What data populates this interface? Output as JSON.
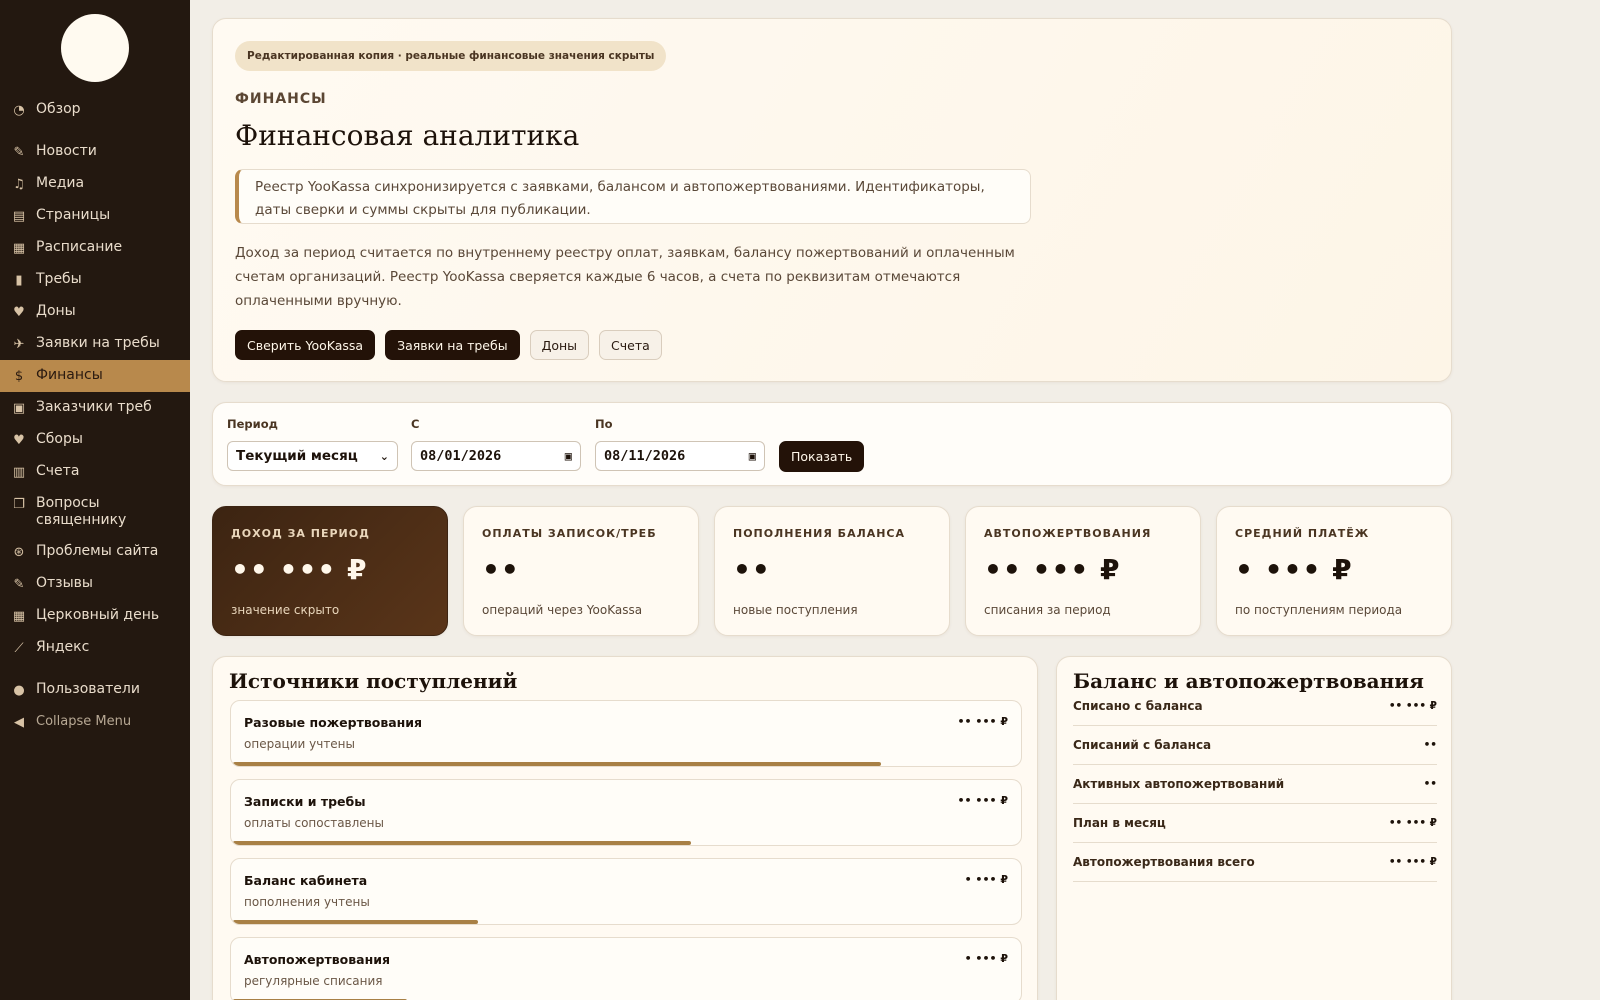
{
  "sidebar": {
    "items": [
      {
        "label": "Обзор",
        "icon": "dashboard-icon"
      },
      {
        "label": "Новости",
        "icon": "pin-icon"
      },
      {
        "label": "Медиа",
        "icon": "media-icon"
      },
      {
        "label": "Страницы",
        "icon": "pages-icon"
      },
      {
        "label": "Расписание",
        "icon": "calendar-icon"
      },
      {
        "label": "Требы",
        "icon": "book-icon"
      },
      {
        "label": "Доны",
        "icon": "heart-icon"
      },
      {
        "label": "Заявки на требы",
        "icon": "send-icon"
      },
      {
        "label": "Финансы",
        "icon": "dollar-icon"
      },
      {
        "label": "Заказчики треб",
        "icon": "id-card-icon"
      },
      {
        "label": "Сборы",
        "icon": "heart-icon"
      },
      {
        "label": "Счета",
        "icon": "invoice-icon"
      },
      {
        "label": "Вопросы священнику",
        "icon": "chat-icon"
      },
      {
        "label": "Проблемы сайта",
        "icon": "lifebuoy-icon"
      },
      {
        "label": "Отзывы",
        "icon": "pin-icon"
      },
      {
        "label": "Церковный день",
        "icon": "calendar-icon"
      },
      {
        "label": "Яндекс",
        "icon": "chart-icon"
      },
      {
        "label": "Пользователи",
        "icon": "user-icon"
      },
      {
        "label": "Collapse Menu",
        "icon": "collapse-icon"
      }
    ]
  },
  "hero": {
    "pill": "Редактированная копия · реальные финансовые значения скрыты",
    "eyebrow": "ФИНАНСЫ",
    "title": "Финансовая аналитика",
    "note": "Реестр YooKassa синхронизируется с заявками, балансом и автопожертвованиями. Идентификаторы, даты сверки и суммы скрыты для публикации.",
    "description": "Доход за период считается по внутреннему реестру оплат, заявкам, балансу пожертвований и оплаченным счетам организаций. Реестр YooKassa сверяется каждые 6 часов, а счета по реквизитам отмечаются оплаченными вручную.",
    "buttons": {
      "reconcile": "Сверить YooKassa",
      "requests": "Заявки на требы",
      "dons": "Доны",
      "invoices": "Счета"
    }
  },
  "filters": {
    "period_label": "Период",
    "period_value": "Текущий месяц",
    "from_label": "С",
    "from_value": "08/01/2026",
    "to_label": "По",
    "to_value": "08/11/2026",
    "show_label": "Показать"
  },
  "kpis": [
    {
      "label": "ДОХОД ЗА ПЕРИОД",
      "value": "•• ••• ₽",
      "sub": "значение скрыто"
    },
    {
      "label": "ОПЛАТЫ ЗАПИСОК/ТРЕБ",
      "value": "••",
      "sub": "операций через YooKassa"
    },
    {
      "label": "ПОПОЛНЕНИЯ БАЛАНСА",
      "value": "••",
      "sub": "новые поступления"
    },
    {
      "label": "АВТОПОЖЕРТВОВАНИЯ",
      "value": "•• ••• ₽",
      "sub": "списания за период"
    },
    {
      "label": "СРЕДНИЙ ПЛАТЁЖ",
      "value": "• ••• ₽",
      "sub": "по поступлениям периода"
    }
  ],
  "sources": {
    "title": "Источники поступлений",
    "items": [
      {
        "name": "Разовые пожертвования",
        "desc": "операции учтены",
        "value": "•• ••• ₽",
        "share": 0.82
      },
      {
        "name": "Записки и требы",
        "desc": "оплаты сопоставлены",
        "value": "•• ••• ₽",
        "share": 0.58
      },
      {
        "name": "Баланс кабинета",
        "desc": "пополнения учтены",
        "value": "• ••• ₽",
        "share": 0.31
      },
      {
        "name": "Автопожертвования",
        "desc": "регулярные списания",
        "value": "• ••• ₽",
        "share": 0.22
      }
    ]
  },
  "balance": {
    "title": "Баланс и автопожертвования",
    "rows": [
      {
        "label": "Списано с баланса",
        "value": "•• ••• ₽"
      },
      {
        "label": "Списаний с баланса",
        "value": "••"
      },
      {
        "label": "Активных автопожертвований",
        "value": "••"
      },
      {
        "label": "План в месяц",
        "value": "•• ••• ₽"
      },
      {
        "label": "Автопожертвования всего",
        "value": "•• ••• ₽"
      }
    ]
  },
  "colors": {
    "sidebar_bg": "#231810",
    "accent": "#b8894c",
    "dark_button": "#231208",
    "page_bg": "#f2eee7"
  }
}
